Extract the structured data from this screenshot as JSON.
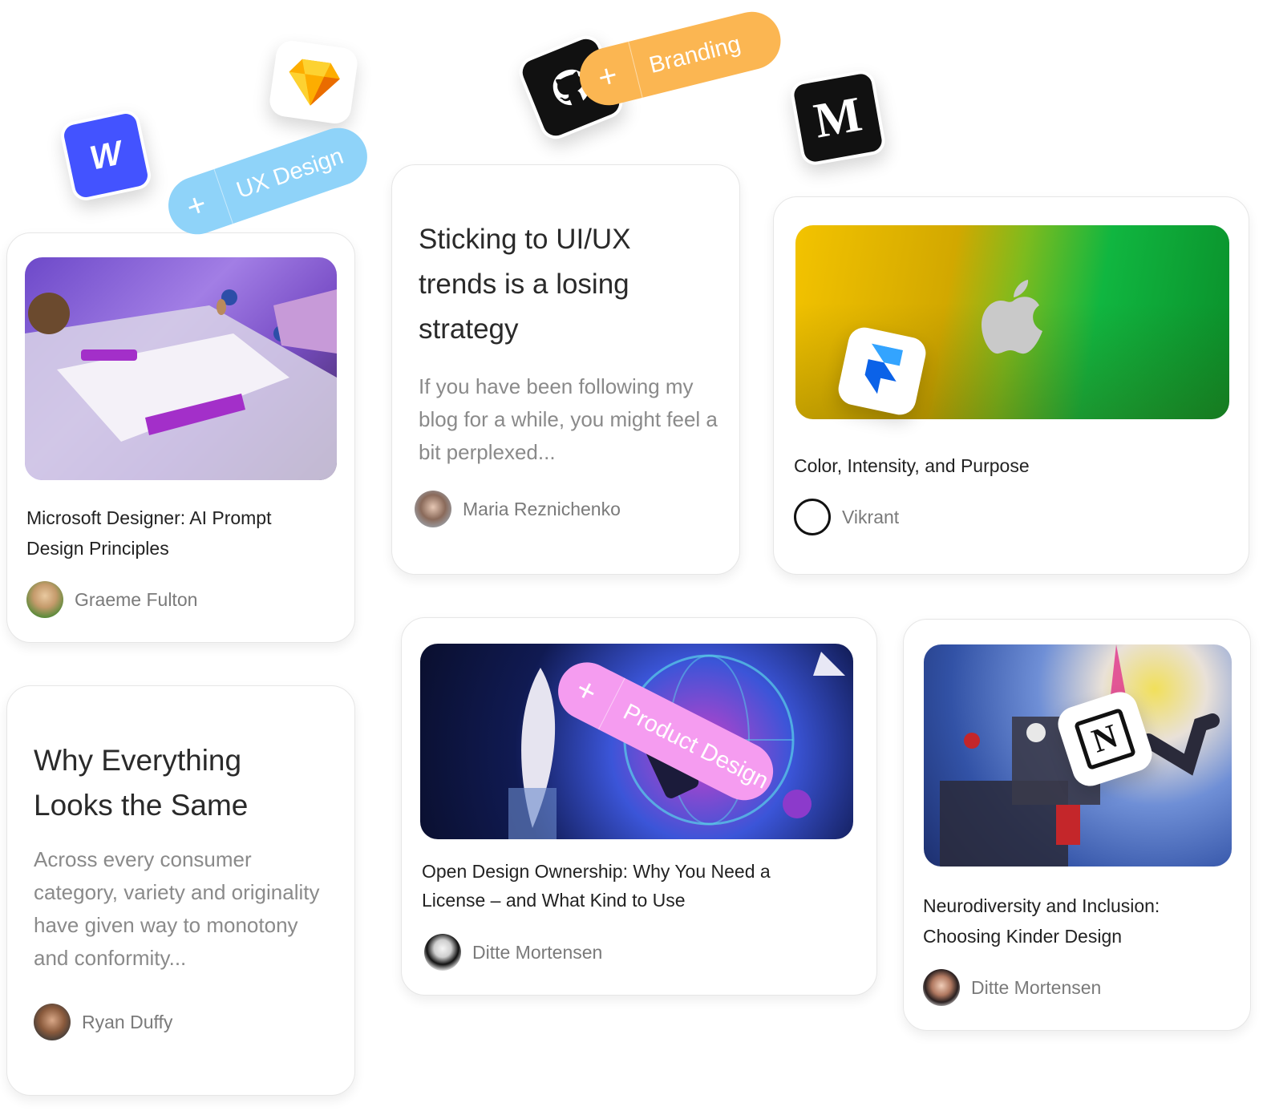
{
  "cards": [
    {
      "title": "Microsoft Designer: AI Prompt Design Principles",
      "author": "Graeme Fulton"
    },
    {
      "title": "Sticking to UI/UX trends is a losing strategy",
      "excerpt": "If you have been following my blog for a while, you might feel a bit perplexed...",
      "author": "Maria Reznichenko"
    },
    {
      "title": "Color, Intensity, and Purpose",
      "author": "Vikrant"
    },
    {
      "title": "Why Everything Looks the Same",
      "excerpt": "Across every consumer category, variety and originality have given way to monotony and conformity...",
      "author": "Ryan Duffy"
    },
    {
      "title": "Open Design Ownership: Why You Need a License – and What Kind to Use",
      "author": "Ditte Mortensen"
    },
    {
      "title": "Neurodiversity and Inclusion: Choosing Kinder Design",
      "author": "Ditte Mortensen"
    }
  ],
  "tags": {
    "ux_design": "UX Design",
    "branding": "Branding",
    "product_design": "Product Design",
    "plus": "+"
  },
  "icons": {
    "webflow_letter": "W",
    "medium_letter": "M",
    "notion_letter": "N"
  },
  "colors": {
    "ux_pill": "#8fd3f9",
    "branding_pill": "#fbb652",
    "product_pill": "#f59cf0",
    "webflow": "#4353ff"
  }
}
